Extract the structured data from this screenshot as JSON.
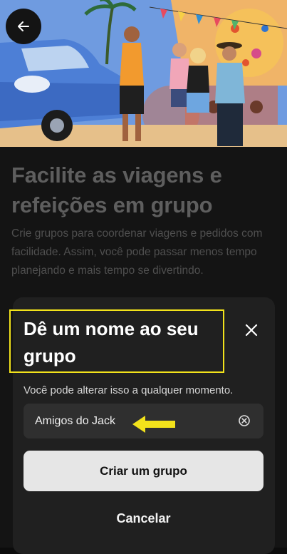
{
  "hero": {
    "image_icon": "group-trip-illustration",
    "back_icon": "arrow-left-icon"
  },
  "background": {
    "title": "Facilite as viagens e refeições em grupo",
    "description": "Crie grupos para coordenar viagens e pedidos com facilidade. Assim, você pode passar menos tempo planejando e mais tempo se divertindo."
  },
  "sheet": {
    "title": "Dê um nome ao seu grupo",
    "hint": "Você pode alterar isso a qualquer momento.",
    "input_value": "Amigos do Jack",
    "close_icon": "close-icon",
    "clear_icon": "clear-circle-icon",
    "create_label": "Criar um grupo",
    "cancel_label": "Cancelar"
  },
  "annotations": {
    "highlight_color": "#f2e21b",
    "arrow_color": "#f2e21b",
    "arrow_icon": "arrow-left-annotation-icon"
  },
  "colors": {
    "sheet_bg": "#202020",
    "button_bg": "#e6e6e6"
  }
}
